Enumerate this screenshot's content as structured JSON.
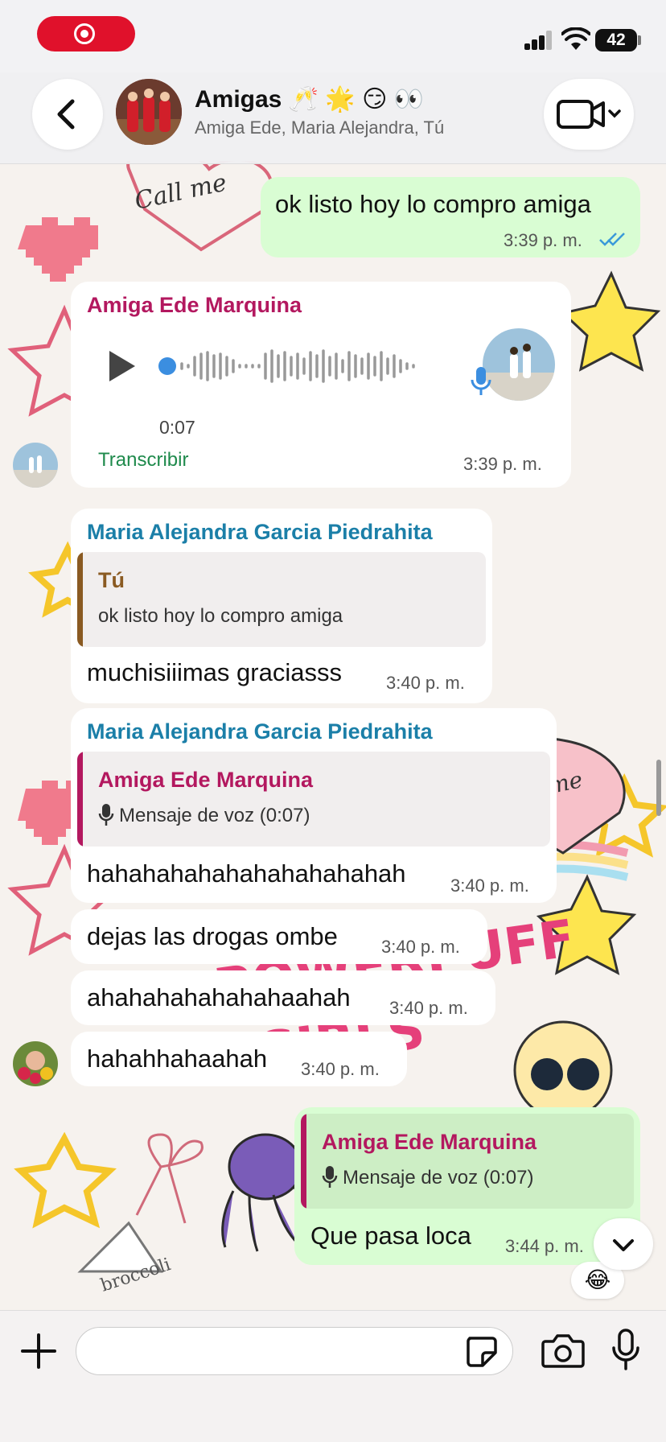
{
  "status_bar": {
    "battery": "42"
  },
  "header": {
    "title": "Amigas 🥂 🌟 😏 👀",
    "participants": "Amiga Ede, Maria Alejandra, Tú"
  },
  "messages": [
    {
      "id": "m1",
      "direction": "out",
      "text": "ok listo hoy lo compro amiga",
      "time": "3:39 p. m.",
      "status": "read"
    },
    {
      "id": "m2",
      "direction": "in",
      "sender": "Amiga Ede Marquina",
      "type": "voice",
      "duration": "0:07",
      "transcribe_label": "Transcribir",
      "time": "3:39 p. m."
    },
    {
      "id": "m3",
      "direction": "in",
      "sender": "Maria Alejandra Garcia Piedrahita",
      "reply_to": {
        "author": "Tú",
        "text": "ok listo hoy lo compro amiga"
      },
      "text": "muchisiiimas graciasss",
      "time": "3:40 p. m."
    },
    {
      "id": "m4",
      "direction": "in",
      "sender": "Maria Alejandra Garcia Piedrahita",
      "reply_to": {
        "author": "Amiga Ede Marquina",
        "text": "Mensaje de voz (0:07)"
      },
      "text": "hahahahahahahahahahahah",
      "time": "3:40 p. m."
    },
    {
      "id": "m5",
      "direction": "in",
      "text": "dejas las drogas ombe",
      "time": "3:40 p. m."
    },
    {
      "id": "m6",
      "direction": "in",
      "text": "ahahahahahahahaahah",
      "time": "3:40 p. m."
    },
    {
      "id": "m7",
      "direction": "in",
      "text": "hahahhahaahah",
      "time": "3:40 p. m."
    },
    {
      "id": "m8",
      "direction": "out",
      "reply_to": {
        "author": "Amiga Ede Marquina",
        "text": "Mensaje de voz (0:07)"
      },
      "text": "Que pasa loca",
      "time": "3:44 p. m.",
      "reaction": "😂"
    }
  ],
  "input": {
    "placeholder": ""
  },
  "colors": {
    "sender_ede": "#b3185f",
    "sender_maria": "#1b7fa8",
    "reply_you": "#8a5a22",
    "transcribe": "#1f8a4c",
    "outgoing_bubble": "#d9fdd3",
    "read_ticks": "#3a9ad9"
  },
  "icons": [
    "back-chevron",
    "video-camera",
    "play",
    "microphone",
    "plus",
    "sticker",
    "camera",
    "scroll-down-chevron"
  ]
}
